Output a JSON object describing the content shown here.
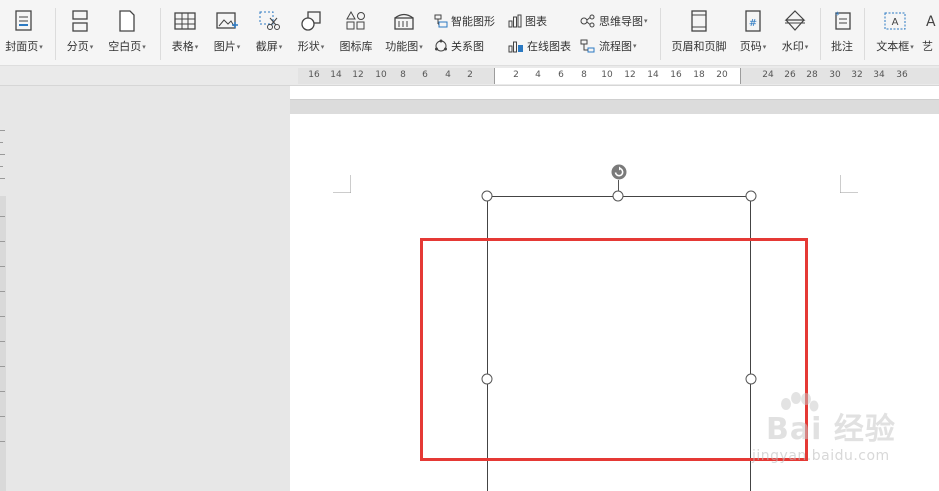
{
  "ribbon": {
    "cover_page": "封面页",
    "page_break": "分页",
    "blank_page": "空白页",
    "table": "表格",
    "picture": "图片",
    "screenshot": "截屏",
    "shapes": "形状",
    "icon_library": "图标库",
    "function_chart": "功能图",
    "smart_graphic": "智能图形",
    "relation_chart": "关系图",
    "chart": "图表",
    "online_chart": "在线图表",
    "mind_map": "思维导图",
    "flowchart": "流程图",
    "header_footer": "页眉和页脚",
    "page_number": "页码",
    "watermark": "水印",
    "comment": "批注",
    "text_box": "文本框",
    "art_text": "艺"
  },
  "ruler": {
    "left_numbers": [
      "16",
      "14",
      "12",
      "10",
      "8",
      "6",
      "4",
      "2"
    ],
    "mid_numbers": [
      "2",
      "4",
      "6",
      "8",
      "10",
      "12",
      "14",
      "16",
      "18",
      "20"
    ],
    "right_numbers": [
      "24",
      "26",
      "28",
      "30",
      "32",
      "34",
      "36"
    ]
  },
  "watermark": {
    "brand": "Bai 经验",
    "url": "jingyan.baidu.com"
  },
  "colors": {
    "highlight": "#e53935",
    "ribbon_bg": "#f5f5f5",
    "workspace_bg": "#e7e7e7",
    "accent_icon": "#2b79c2"
  }
}
